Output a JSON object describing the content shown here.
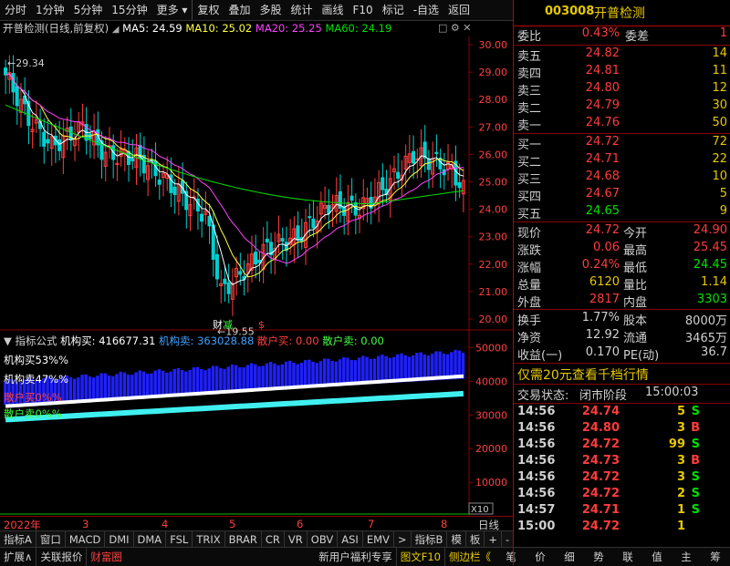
{
  "toolbar": {
    "items": [
      "分时",
      "1分钟",
      "5分钟",
      "15分钟",
      "更多",
      "复权",
      "叠加",
      "多股",
      "统计",
      "画线",
      "F10",
      "标记",
      "-自选",
      "返回"
    ]
  },
  "stock": {
    "code": "003008",
    "name": "开普检测"
  },
  "main_info": {
    "title": "开普检测(日线,前复权)",
    "ma5": "MA5: 24.59",
    "ma10": "MA10: 25.02",
    "ma20": "MA20: 25.25",
    "ma60": "MA60: 24.19"
  },
  "chart_data": [
    {
      "type": "candlestick",
      "yaxis_ticks": [
        "30.00",
        "29.00",
        "28.00",
        "27.00",
        "26.00",
        "25.00",
        "24.00",
        "23.00",
        "22.00",
        "21.00",
        "20.00"
      ],
      "ylim": [
        19.6,
        30.3
      ],
      "annotations": {
        "high": "29.34",
        "low": "19.55"
      },
      "markers": [
        "财",
        "减",
        "$"
      ]
    },
    {
      "type": "area",
      "yaxis_ticks": [
        "50000",
        "40000",
        "30000",
        "20000",
        "10000"
      ],
      "multiplier": "X10"
    }
  ],
  "sub_info": {
    "formula": "指标公式",
    "jg_buy": "机构买: 416677.31",
    "jg_sell": "机构卖: 363028.88",
    "sh_buy": "散户买: 0.00",
    "sh_sell": "散户卖: 0.00",
    "pct1": "机构买53%%",
    "pct2": "机构卖47%%",
    "pct3": "散户买0%%",
    "pct4": "散户卖0%%"
  },
  "xaxis": [
    "2022年",
    "3",
    "4",
    "5",
    "6",
    "7",
    "8"
  ],
  "xaxis_right": "日线",
  "tabs": [
    "指标A",
    "窗口",
    "MACD",
    "DMI",
    "DMA",
    "FSL",
    "TRIX",
    "BRAR",
    "CR",
    "VR",
    "OBV",
    "ASI",
    "EMV",
    ">",
    "指标B",
    "模",
    "板",
    "+",
    "-"
  ],
  "status": {
    "left": [
      "扩展∧",
      "关联报价",
      "财富圈"
    ],
    "right": [
      "新用户福利专享",
      "图文F10",
      "侧边栏《"
    ],
    "icons": [
      "笔",
      "价",
      "细",
      "势",
      "联",
      "值",
      "主",
      "筹"
    ]
  },
  "quote": {
    "weibi_label": "委比",
    "weibi": "0.43%",
    "weicha_label": "委差",
    "weicha": "1",
    "sells": [
      {
        "label": "卖五",
        "price": "24.82",
        "vol": "14"
      },
      {
        "label": "卖四",
        "price": "24.81",
        "vol": "11"
      },
      {
        "label": "卖三",
        "price": "24.80",
        "vol": "12"
      },
      {
        "label": "卖二",
        "price": "24.79",
        "vol": "30"
      },
      {
        "label": "卖一",
        "price": "24.76",
        "vol": "50"
      }
    ],
    "buys": [
      {
        "label": "买一",
        "price": "24.72",
        "vol": "72"
      },
      {
        "label": "买二",
        "price": "24.71",
        "vol": "22"
      },
      {
        "label": "买三",
        "price": "24.68",
        "vol": "10"
      },
      {
        "label": "买四",
        "price": "24.67",
        "vol": "5"
      },
      {
        "label": "买五",
        "price": "24.65",
        "vol": "9"
      }
    ],
    "stats": [
      {
        "l1": "现价",
        "v1": "24.72",
        "l2": "今开",
        "v2": "24.90"
      },
      {
        "l1": "涨跌",
        "v1": "0.06",
        "l2": "最高",
        "v2": "25.45"
      },
      {
        "l1": "涨幅",
        "v1": "0.24%",
        "l2": "最低",
        "v2": "24.45"
      },
      {
        "l1": "总量",
        "v1": "6120",
        "l2": "量比",
        "v2": "1.14"
      },
      {
        "l1": "外盘",
        "v1": "2817",
        "l2": "内盘",
        "v2": "3303"
      }
    ],
    "fund": [
      {
        "l1": "换手",
        "v1": "1.77%",
        "l2": "股本",
        "v2": "8000万"
      },
      {
        "l1": "净资",
        "v1": "12.92",
        "l2": "流通",
        "v2": "3465万"
      },
      {
        "l1": "收益(一)",
        "v1": "0.170",
        "l2": "PE(动)",
        "v2": "36.7"
      }
    ],
    "promo": "仅需20元查看千档行情",
    "trade_status_label": "交易状态:",
    "trade_status": "闭市阶段",
    "trade_time": "15:00:03",
    "ticks": [
      {
        "t": "14:56",
        "p": "24.74",
        "v": "5",
        "d": "S"
      },
      {
        "t": "14:56",
        "p": "24.80",
        "v": "3",
        "d": "B"
      },
      {
        "t": "14:56",
        "p": "24.72",
        "v": "99",
        "d": "S"
      },
      {
        "t": "14:56",
        "p": "24.73",
        "v": "3",
        "d": "B"
      },
      {
        "t": "14:56",
        "p": "24.72",
        "v": "3",
        "d": "S"
      },
      {
        "t": "14:56",
        "p": "24.72",
        "v": "2",
        "d": "S"
      },
      {
        "t": "14:57",
        "p": "24.71",
        "v": "1",
        "d": "S"
      },
      {
        "t": "15:00",
        "p": "24.72",
        "v": "1",
        "d": ""
      }
    ]
  },
  "colors": {
    "up": "#ff3c3c",
    "down": "#00d0d0",
    "ma5": "#ffffff",
    "ma10": "#ffff40",
    "ma20": "#ff40ff",
    "ma60": "#00e000",
    "grid": "#8a0000",
    "bluebar": "#1f20ff",
    "cyan": "#40f0f0"
  }
}
